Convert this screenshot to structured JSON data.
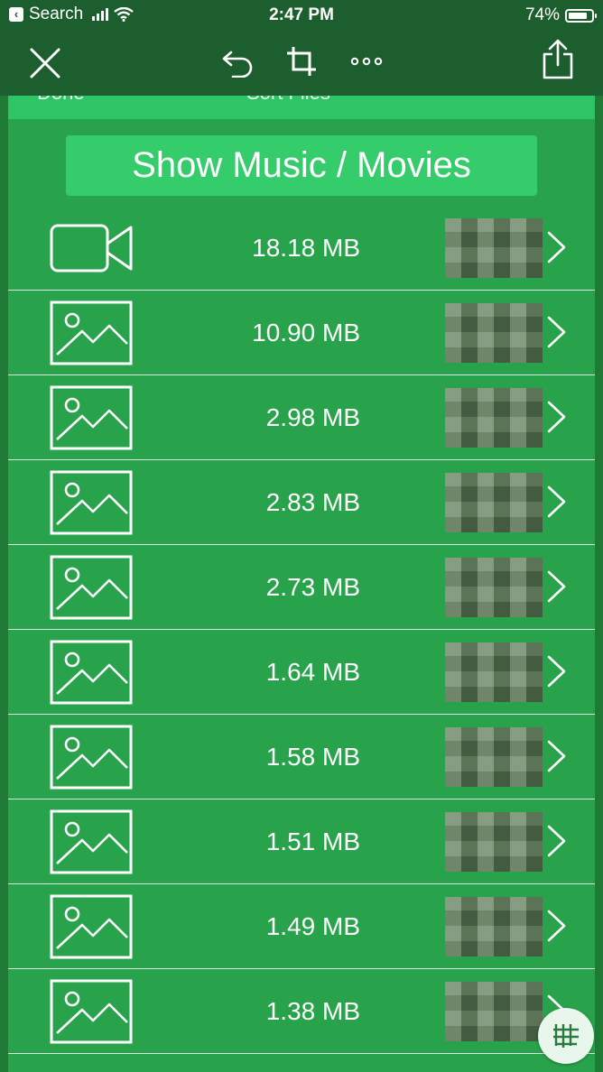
{
  "status_bar": {
    "back_label": "Search",
    "time": "2:47 PM",
    "battery": "74%",
    "battery_level": 0.74
  },
  "toolbar": {
    "close_icon": "close-icon",
    "undo_icon": "undo-icon",
    "crop_icon": "crop-icon",
    "more_icon": "more-icon",
    "share_icon": "share-icon"
  },
  "panel": {
    "header_left": "Done",
    "header_right": "Sort Files",
    "show_button": "Show Music / Movies"
  },
  "files": [
    {
      "icon": "video-icon",
      "size": "18.18 MB"
    },
    {
      "icon": "image-icon",
      "size": "10.90 MB"
    },
    {
      "icon": "image-icon",
      "size": "2.98 MB"
    },
    {
      "icon": "image-icon",
      "size": "2.83 MB"
    },
    {
      "icon": "image-icon",
      "size": "2.73 MB"
    },
    {
      "icon": "image-icon",
      "size": "1.64 MB"
    },
    {
      "icon": "image-icon",
      "size": "1.58 MB"
    },
    {
      "icon": "image-icon",
      "size": "1.51 MB"
    },
    {
      "icon": "image-icon",
      "size": "1.49 MB"
    },
    {
      "icon": "image-icon",
      "size": "1.38 MB"
    }
  ],
  "colors": {
    "bar": "#1d5e2e",
    "panel": "#28a24b",
    "accent_button": "#35cc6c"
  }
}
